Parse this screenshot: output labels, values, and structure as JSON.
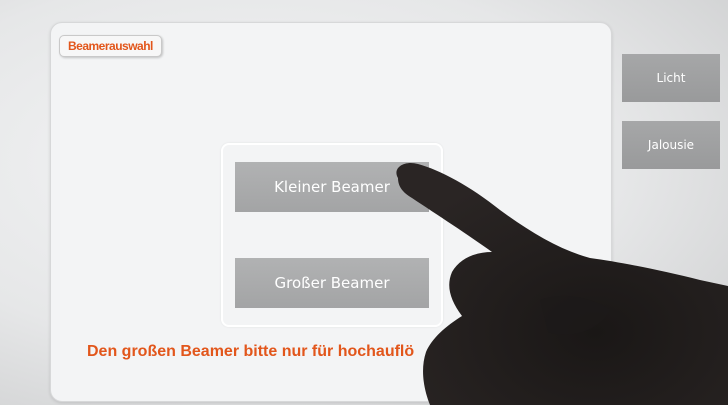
{
  "panel": {
    "title": "Beamerauswahl",
    "buttons": {
      "small_beamer": "Kleiner Beamer",
      "large_beamer": "Großer Beamer"
    },
    "notice": "Den großen Beamer bitte nur für hochauflö"
  },
  "sidebar": {
    "light": "Licht",
    "blinds": "Jalousie"
  },
  "colors": {
    "accent_orange": "#e2561b",
    "button_gray": "#a8a9aa"
  }
}
